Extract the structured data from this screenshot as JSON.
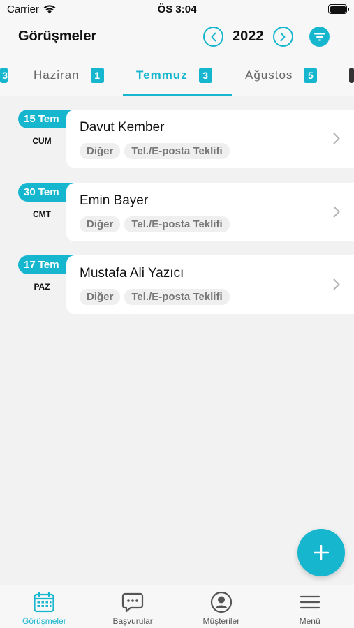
{
  "status_bar": {
    "carrier": "Carrier",
    "time": "ÖS 3:04"
  },
  "header": {
    "title": "Görüşmeler",
    "year": "2022"
  },
  "month_tabs": [
    {
      "label": "Haziran",
      "count": "1",
      "active": false
    },
    {
      "label": "Temmuz",
      "count": "3",
      "active": true
    },
    {
      "label": "Ağustos",
      "count": "5",
      "active": false
    }
  ],
  "meetings": [
    {
      "date": "15 Tem",
      "weekday": "CUM",
      "name": "Davut Kember",
      "tags": [
        "Diğer",
        "Tel./E-posta Teklifi"
      ]
    },
    {
      "date": "30 Tem",
      "weekday": "CMT",
      "name": "Emin Bayer",
      "tags": [
        "Diğer",
        "Tel./E-posta Teklifi"
      ]
    },
    {
      "date": "17 Tem",
      "weekday": "PAZ",
      "name": "Mustafa Ali Yazıcı",
      "tags": [
        "Diğer",
        "Tel./E-posta Teklifi"
      ]
    }
  ],
  "tab_bar": [
    {
      "label": "Görüşmeler",
      "icon": "calendar-icon",
      "active": true
    },
    {
      "label": "Başvurular",
      "icon": "chat-bubble-icon",
      "active": false
    },
    {
      "label": "Müşteriler",
      "icon": "user-circle-icon",
      "active": false
    },
    {
      "label": "Menü",
      "icon": "hamburger-menu-icon",
      "active": false
    }
  ],
  "colors": {
    "accent": "#17b6cf",
    "background": "#f2f2f2",
    "card": "#ffffff",
    "chip": "#efefef"
  }
}
